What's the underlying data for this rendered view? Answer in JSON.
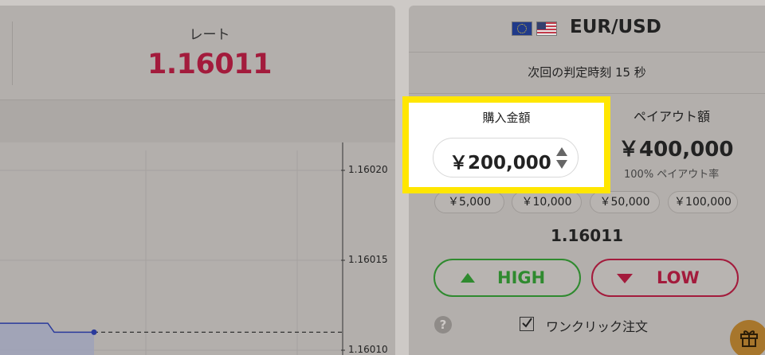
{
  "rate_panel": {
    "label": "レート",
    "value": "1.16011"
  },
  "chart_data": {
    "type": "area",
    "y_ticks": [
      "1.16020",
      "1.16015",
      "1.16010"
    ],
    "ylim": [
      1.16009,
      1.16022
    ],
    "series": [
      {
        "x": [
          0,
          60,
          68,
          118
        ],
        "values": [
          1.160115,
          1.160115,
          1.16011,
          1.16011
        ]
      }
    ],
    "current_level": 1.16011,
    "grid": true,
    "colors": {
      "area": "#9da2b8",
      "line": "#2a3a9c",
      "dashed": "#333333"
    }
  },
  "trade_panel": {
    "pair": "EUR/USD",
    "flags": [
      "eu-flag-icon",
      "us-flag-icon"
    ],
    "timer_text": "次回の判定時刻 15 秒",
    "purchase": {
      "title": "購入金額",
      "amount": "￥200,000"
    },
    "payout": {
      "title": "ペイアウト額",
      "amount": "￥400,000",
      "rate_text": "100% ペイアウト率"
    },
    "quick_amounts": [
      "￥5,000",
      "￥10,000",
      "￥50,000",
      "￥100,000"
    ],
    "current_rate": "1.16011",
    "high_label": "HIGH",
    "low_label": "LOW",
    "help_symbol": "?",
    "one_click_label": "ワンクリック注文",
    "one_click_checked": true
  },
  "colors": {
    "accent_red": "#a31b3c",
    "accent_green": "#2f8a2f",
    "highlight": "#ffe600"
  }
}
